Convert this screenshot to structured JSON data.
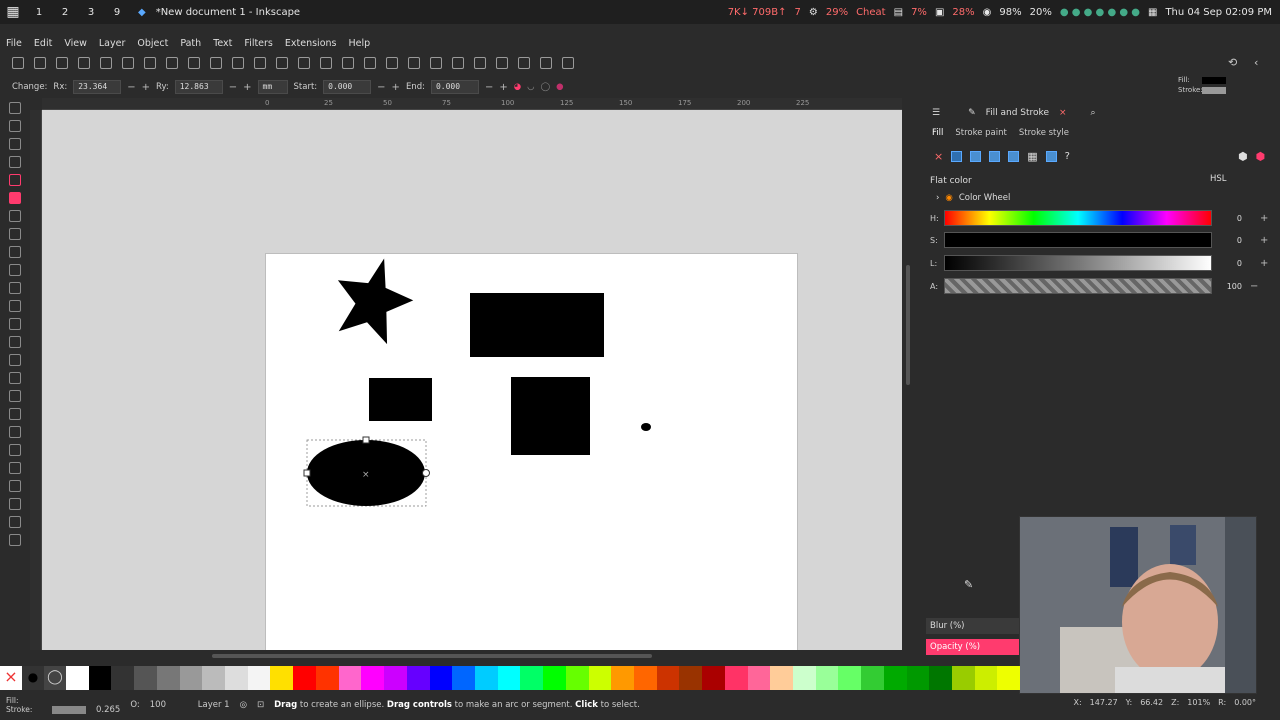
{
  "topbar": {
    "workspaces": [
      "1",
      "2",
      "3",
      "9"
    ],
    "window_title": "*New document 1 - Inkscape",
    "net": "7K↓ 709B↑",
    "cpu_count": "7",
    "cpu": "29%",
    "cheat": "Cheat",
    "mem": "7%",
    "disk": "28%",
    "vol": "98%",
    "bat": "20%",
    "datetime": "Thu 04 Sep 02:09 PM"
  },
  "menubar": [
    "File",
    "Edit",
    "View",
    "Layer",
    "Object",
    "Path",
    "Text",
    "Filters",
    "Extensions",
    "Help"
  ],
  "controls": {
    "change_label": "Change:",
    "rx_label": "Rx:",
    "rx": "23.364",
    "ry_label": "Ry:",
    "ry": "12.863",
    "unit": "mm",
    "start_label": "Start:",
    "start": "0.000",
    "end_label": "End:",
    "end": "0.000"
  },
  "fill_stroke_indicator": {
    "fill_label": "Fill:",
    "stroke_label": "Stroke:"
  },
  "ruler_ticks": [
    "0",
    "25",
    "50",
    "75",
    "100",
    "125",
    "150",
    "175",
    "200",
    "225"
  ],
  "canvas": {
    "shapes": [
      {
        "kind": "star",
        "name": "star-shape"
      },
      {
        "kind": "rect",
        "name": "wide-rectangle"
      },
      {
        "kind": "rect",
        "name": "small-rectangle"
      },
      {
        "kind": "rect",
        "name": "square-rectangle"
      },
      {
        "kind": "ellipse",
        "name": "selected-ellipse"
      },
      {
        "kind": "dot",
        "name": "tiny-ellipse"
      }
    ]
  },
  "panel": {
    "tab_title": "Fill and Stroke",
    "tabs": [
      "Fill",
      "Stroke paint",
      "Stroke style"
    ],
    "flat_color": "Flat color",
    "mode": "HSL",
    "color_wheel": "Color Wheel",
    "sliders": [
      {
        "label": "H:",
        "value": "0"
      },
      {
        "label": "S:",
        "value": "0"
      },
      {
        "label": "L:",
        "value": "0"
      },
      {
        "label": "A:",
        "value": "100"
      }
    ],
    "blur_label": "Blur (%)",
    "opacity_label": "Opacity (%)"
  },
  "palette_colors": [
    "#ffffff",
    "#000000",
    "#333333",
    "#555555",
    "#777777",
    "#999999",
    "#bbbbbb",
    "#dddddd",
    "#f4f4f4",
    "#ffe000",
    "#ff0000",
    "#ff3300",
    "#ff66cc",
    "#ff00ff",
    "#cc00ff",
    "#6600ff",
    "#0000ff",
    "#0066ff",
    "#00ccff",
    "#00ffff",
    "#00ff66",
    "#00ff00",
    "#66ff00",
    "#ccff00",
    "#ff9900",
    "#ff6600",
    "#cc3300",
    "#993300",
    "#aa0000",
    "#ff3366",
    "#ff6699",
    "#ffcc99",
    "#ccffcc",
    "#99ff99",
    "#66ff66",
    "#33cc33",
    "#00aa00",
    "#009900",
    "#007700",
    "#99cc00",
    "#ccee00",
    "#eeff00"
  ],
  "status": {
    "fill_label": "Fill:",
    "stroke_label": "Stroke:",
    "stroke_width": "0.265",
    "opacity_label": "O:",
    "opacity": "100",
    "layer": "Layer 1",
    "msg_pre": "Drag",
    "msg_a": " to create an ellipse. ",
    "msg_b_bold": "Drag controls",
    "msg_c": " to make an arc or segment. ",
    "msg_d_bold": "Click",
    "msg_e": " to select.",
    "x_label": "X:",
    "x": "147.27",
    "y_label": "Y:",
    "y": "66.42",
    "zoom_label": "Z:",
    "zoom": "101%",
    "rot_label": "R:",
    "rot": "0.00°"
  }
}
